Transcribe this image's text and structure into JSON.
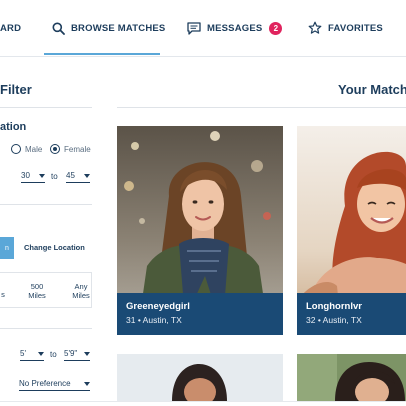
{
  "nav": {
    "items": [
      {
        "label": "ARD",
        "icon": "dashboard-icon"
      },
      {
        "label": "BROWSE MATCHES",
        "icon": "search-icon"
      },
      {
        "label": "MESSAGES",
        "icon": "chat-icon",
        "badge": "2"
      },
      {
        "label": "FAVORITES",
        "icon": "star-icon"
      }
    ],
    "active": "BROWSE MATCHES"
  },
  "filter": {
    "title": "Filter",
    "location_section": "ation",
    "gender": {
      "male_label": "Male",
      "female_label": "Female",
      "selected": "Female"
    },
    "age": {
      "from": "30",
      "to_label": "to",
      "to": "45"
    },
    "location_button": "n",
    "change_location": "Change Location",
    "distance_options": [
      {
        "line1": "s",
        "line2": ""
      },
      {
        "line1": "500",
        "line2": "Miles"
      },
      {
        "line1": "Any",
        "line2": "Miles"
      }
    ],
    "height": {
      "from": "5'",
      "to_label": "to",
      "to": "5'9\""
    },
    "preference": "No Preference"
  },
  "matches": {
    "title": "Your Matches",
    "cards": [
      {
        "name": "Greeneyedgirl",
        "details": "31 • Austin, TX"
      },
      {
        "name": "Longhornlvr",
        "details": "32 • Austin, TX"
      }
    ]
  },
  "colors": {
    "primary": "#1d3d5c",
    "accent": "#5aa7d8",
    "caption": "#1a4a75",
    "badge": "#e0245e"
  }
}
